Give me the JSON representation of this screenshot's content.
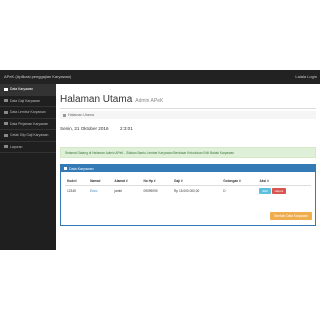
{
  "topbar": {
    "brand": "APeK (Aplikasi penggajian Karyawan)",
    "user": "Lalala Login"
  },
  "sidebar": {
    "items": [
      {
        "label": "Data Karyawan",
        "active": true
      },
      {
        "label": "Data Gaji Karyawan"
      },
      {
        "label": "Data Lembur Karyawan"
      },
      {
        "label": "Data Pinjaman Karyawan"
      },
      {
        "label": "Cetak Slip Gaji Karyawan"
      },
      {
        "label": "Laporan"
      }
    ]
  },
  "main": {
    "title": "Halaman Utama",
    "subtitle": "Admin APeK",
    "breadcrumb": "Halaman Utama",
    "datetime": "Senin, 31 Oktober 2016         2:3:01",
    "alert": "Selamat Datang di Halaman Admin APeK , Silakan Bantu Lembar Karyawan Berdasar Kebutuhan Edit Bahak Karyawan"
  },
  "panel": {
    "title": "Data Karyawan",
    "columns": [
      "Kode#",
      "Nama#",
      "Alamat #",
      "No Hp #",
      "Gaji #",
      "Golongan #",
      "Aksi #"
    ],
    "rows": [
      {
        "kode": "12345",
        "nama": "Enzo",
        "alamat": "jambi",
        "hp": "09099090",
        "gaji": "Rp 15.000.000,00",
        "golongan": "D",
        "edit": "Edit",
        "hapus": "Hapus"
      }
    ],
    "add_button": "Tambah Data Karyawan"
  }
}
